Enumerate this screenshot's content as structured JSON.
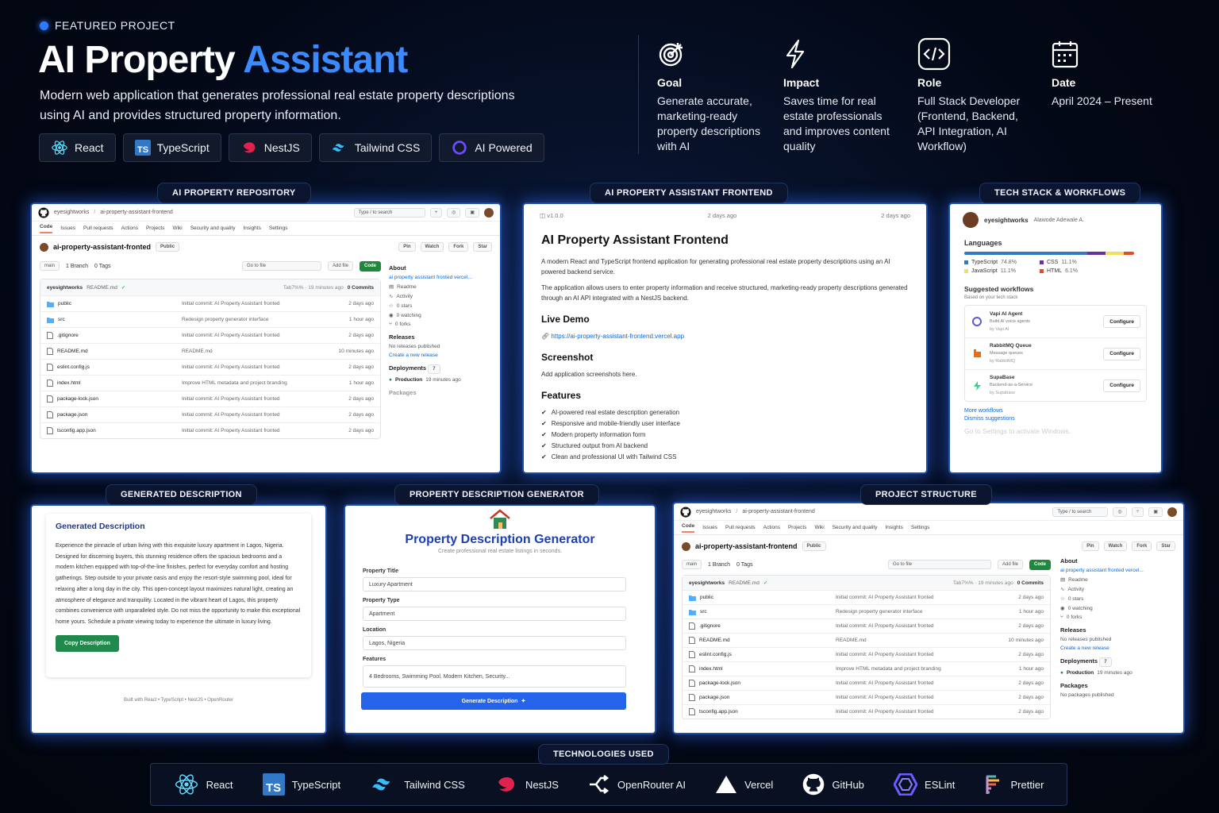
{
  "header": {
    "eyebrow": "FEATURED PROJECT",
    "title_main": "AI Property",
    "title_accent": "Assistant",
    "subtitle": "Modern web application that generates professional real estate property descriptions using AI and provides structured property information."
  },
  "chips": [
    "React",
    "TypeScript",
    "NestJS",
    "Tailwind CSS",
    "AI Powered"
  ],
  "info": [
    {
      "icon": "target-icon",
      "title": "Goal",
      "text": "Generate accurate, marketing-ready property descriptions with AI"
    },
    {
      "icon": "lightning-icon",
      "title": "Impact",
      "text": "Saves time for real estate professionals and improves content quality"
    },
    {
      "icon": "code-icon",
      "title": "Role",
      "text": "Full Stack Developer (Frontend, Backend, API Integration, AI Workflow)"
    },
    {
      "icon": "calendar-icon",
      "title": "Date",
      "text": "April 2024 – Present"
    }
  ],
  "panel_tags": {
    "repo": "AI PROPERTY REPOSITORY",
    "frontend": "AI PROPERTY ASSISTANT FRONTEND",
    "tech": "TECH STACK & WORKFLOWS",
    "generated": "GENERATED DESCRIPTION",
    "generator": "PROPERTY DESCRIPTION GENERATOR",
    "structure": "PROJECT STRUCTURE"
  },
  "github": {
    "owner": "eyesightworks",
    "sep": "/",
    "repo_path": "ai-property-assistant-frontend",
    "search": "Type / to search",
    "nav": [
      "Code",
      "Issues",
      "Pull requests",
      "Actions",
      "Projects",
      "Wiki",
      "Security and quality",
      "Insights",
      "Settings"
    ],
    "repo_name_a": "ai-property-assistant-fronted",
    "repo_name_b": "ai-property-assistant-frontend",
    "visibility": "Public",
    "branch": "main",
    "branches": "1 Branch",
    "tags": "0 Tags",
    "goto": "Go to file",
    "add_file": "Add file",
    "code_btn": "Code",
    "commit_author": "eyesightworks",
    "commit_msg": "README.md",
    "commit_meta": "Tab7%% · 19 minutes ago",
    "commits": "0 Commits",
    "files": [
      {
        "name": "public",
        "type": "folder",
        "msg": "Initial commit: AI Property Assistant fronted",
        "time": "2 days ago"
      },
      {
        "name": "src",
        "type": "folder",
        "msg": "Redesign property generator interface",
        "time": "1 hour ago"
      },
      {
        "name": ".gitignore",
        "type": "file",
        "msg": "Initial commit: AI Property Assistant fronted",
        "time": "2 days ago"
      },
      {
        "name": "README.md",
        "type": "file",
        "msg": "README.md",
        "time": "10 minutes ago"
      },
      {
        "name": "eslint.config.js",
        "type": "file",
        "msg": "Initial commit: AI Property Assistant fronted",
        "time": "2 days ago"
      },
      {
        "name": "index.html",
        "type": "file",
        "msg": "Improve HTML metadata and project branding",
        "time": "1 hour ago"
      },
      {
        "name": "package-lock.json",
        "type": "file",
        "msg": "Initial commit: AI Property Assistant fronted",
        "time": "2 days ago"
      },
      {
        "name": "package.json",
        "type": "file",
        "msg": "Initial commit: AI Property Assistant fronted",
        "time": "2 days ago"
      },
      {
        "name": "tsconfig.app.json",
        "type": "file",
        "msg": "Initial commit: AI Property Assistant fronted",
        "time": "2 days ago"
      }
    ],
    "about": "About",
    "about_link": "ai property assistant fronted vercel...",
    "readme": "Readme",
    "activity": "Activity",
    "stars": "0 stars",
    "watching": "0 watching",
    "forks": "0 forks",
    "releases": "Releases",
    "no_releases": "No releases published",
    "create_release": "Create a new release",
    "deployments": "Deployments",
    "deploy_count": "7",
    "production": "Production",
    "prod_time": "19 minutes ago",
    "packages": "Packages",
    "no_packages": "No packages published",
    "btn_pin": "Pin",
    "btn_watch": "Watch",
    "btn_fork": "Fork",
    "btn_star": "Star"
  },
  "frontend": {
    "version": "v1.0.0",
    "time_a": "2 days ago",
    "time_b": "2 days ago",
    "title": "AI Property Assistant Frontend",
    "p1": "A modern React and TypeScript frontend application for generating professional real estate property descriptions using an AI powered backend service.",
    "p2": "The application allows users to enter property information and receive structured, marketing-ready property descriptions generated through an AI API integrated with a NestJS backend.",
    "live_demo": "Live Demo",
    "url": "https://ai-property-assistant-frontend.vercel.app",
    "screenshot": "Screenshot",
    "screenshot_text": "Add application screenshots here.",
    "features": "Features",
    "feature_list": [
      "AI-powered real estate description generation",
      "Responsive and mobile-friendly user interface",
      "Modern property information form",
      "Structured output from AI backend",
      "Clean and professional UI with Tailwind CSS"
    ]
  },
  "techpanel": {
    "user": "eyesightworks",
    "full_name": "Alawode Adewale A.",
    "languages": "Languages",
    "langs": [
      {
        "name": "TypeScript",
        "pct": "74.8%",
        "color": "#3178c6"
      },
      {
        "name": "CSS",
        "pct": "11.1%",
        "color": "#663399"
      },
      {
        "name": "JavaScript",
        "pct": "11.1%",
        "color": "#f1e05a"
      },
      {
        "name": "HTML",
        "pct": "6.1%",
        "color": "#e34c26"
      }
    ],
    "suggested": "Suggested workflows",
    "based": "Based on your tech stack",
    "workflows": [
      {
        "name": "Vapi AI Agent",
        "desc": "Build AI voice agents",
        "by": "by Vapi AI",
        "btn": "Configure"
      },
      {
        "name": "RabbitMQ Queue",
        "desc": "Message queues",
        "by": "by RabbitMQ",
        "btn": "Configure"
      },
      {
        "name": "SupaBase",
        "desc": "Backend-as-a-Service",
        "by": "by Supabase",
        "btn": "Configure"
      }
    ],
    "more": "More workflows",
    "dismiss": "Dismiss suggestions",
    "activate": "Go to Settings to activate Windows."
  },
  "generated": {
    "heading": "Generated Description",
    "body": "Experience the pinnacle of urban living with this exquisite luxury apartment in Lagos, Nigeria. Designed for discerning buyers, this stunning residence offers the spacious bedrooms and a modern kitchen equipped with top-of-the-line finishes, perfect for everyday comfort and hosting gatherings. Step outside to your private oasis and enjoy the resort-style swimming pool, ideal for relaxing after a long day in the city. This open-concept layout maximizes natural light, creating an atmosphere of elegance and tranquility. Located in the vibrant heart of Lagos, this property combines convenience with unparalleled style. Do not miss the opportunity to make this exceptional home yours. Schedule a private viewing today to experience the ultimate in luxury living.",
    "copy_btn": "Copy Description",
    "footer": "Built with React • TypeScript • NestJS • OpenRouter"
  },
  "generator": {
    "title": "Property Description Generator",
    "subtitle": "Create professional real estate listings in seconds.",
    "fields": [
      {
        "label": "Property Title",
        "value": "Luxury Apartment"
      },
      {
        "label": "Property Type",
        "value": "Apartment"
      },
      {
        "label": "Location",
        "value": "Lagos, Nigeria"
      },
      {
        "label": "Features",
        "value": "4 Bedrooms, Swimming Pool, Modern Kitchen, Security..."
      }
    ],
    "button": "Generate Description"
  },
  "tech_used": {
    "label": "TECHNOLOGIES USED",
    "items": [
      "React",
      "TypeScript",
      "Tailwind CSS",
      "NestJS",
      "OpenRouter AI",
      "Vercel",
      "GitHub",
      "ESLint",
      "Prettier"
    ]
  },
  "colors": {
    "accent": "#3b8bff",
    "green": "#1f883d",
    "blue_btn": "#2563eb"
  }
}
